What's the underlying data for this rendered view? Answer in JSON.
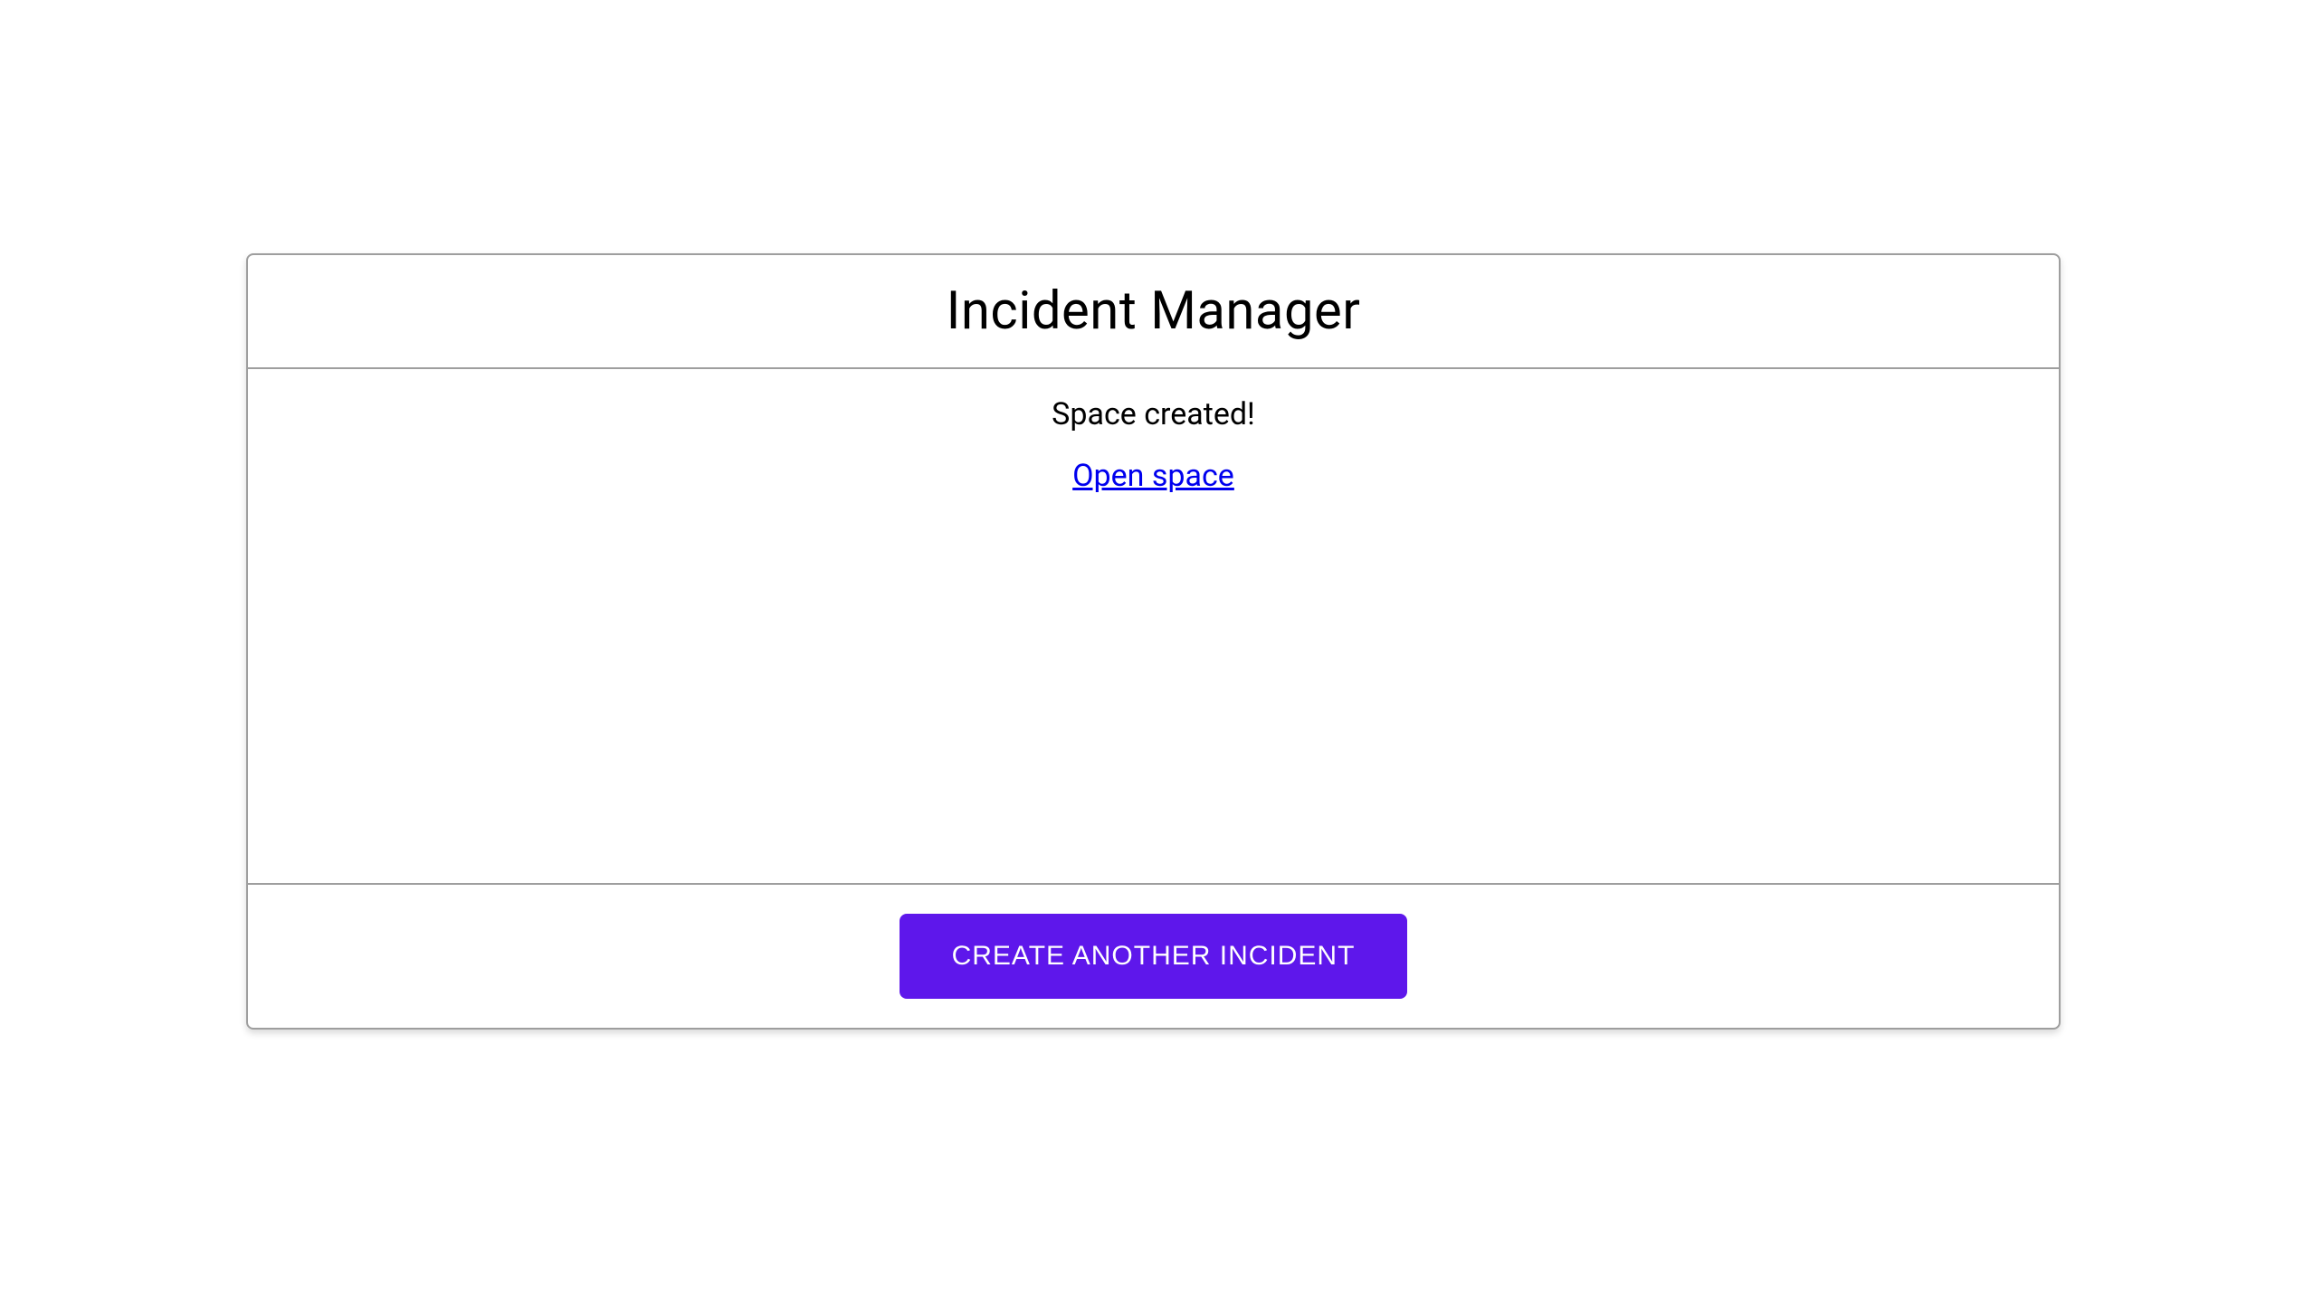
{
  "header": {
    "title": "Incident Manager"
  },
  "body": {
    "status_message": "Space created!",
    "link_text": "Open space"
  },
  "footer": {
    "button_label": "CREATE ANOTHER INCIDENT"
  },
  "colors": {
    "accent": "#5e17eb",
    "link": "#0000ee",
    "border": "#9e9e9e"
  }
}
